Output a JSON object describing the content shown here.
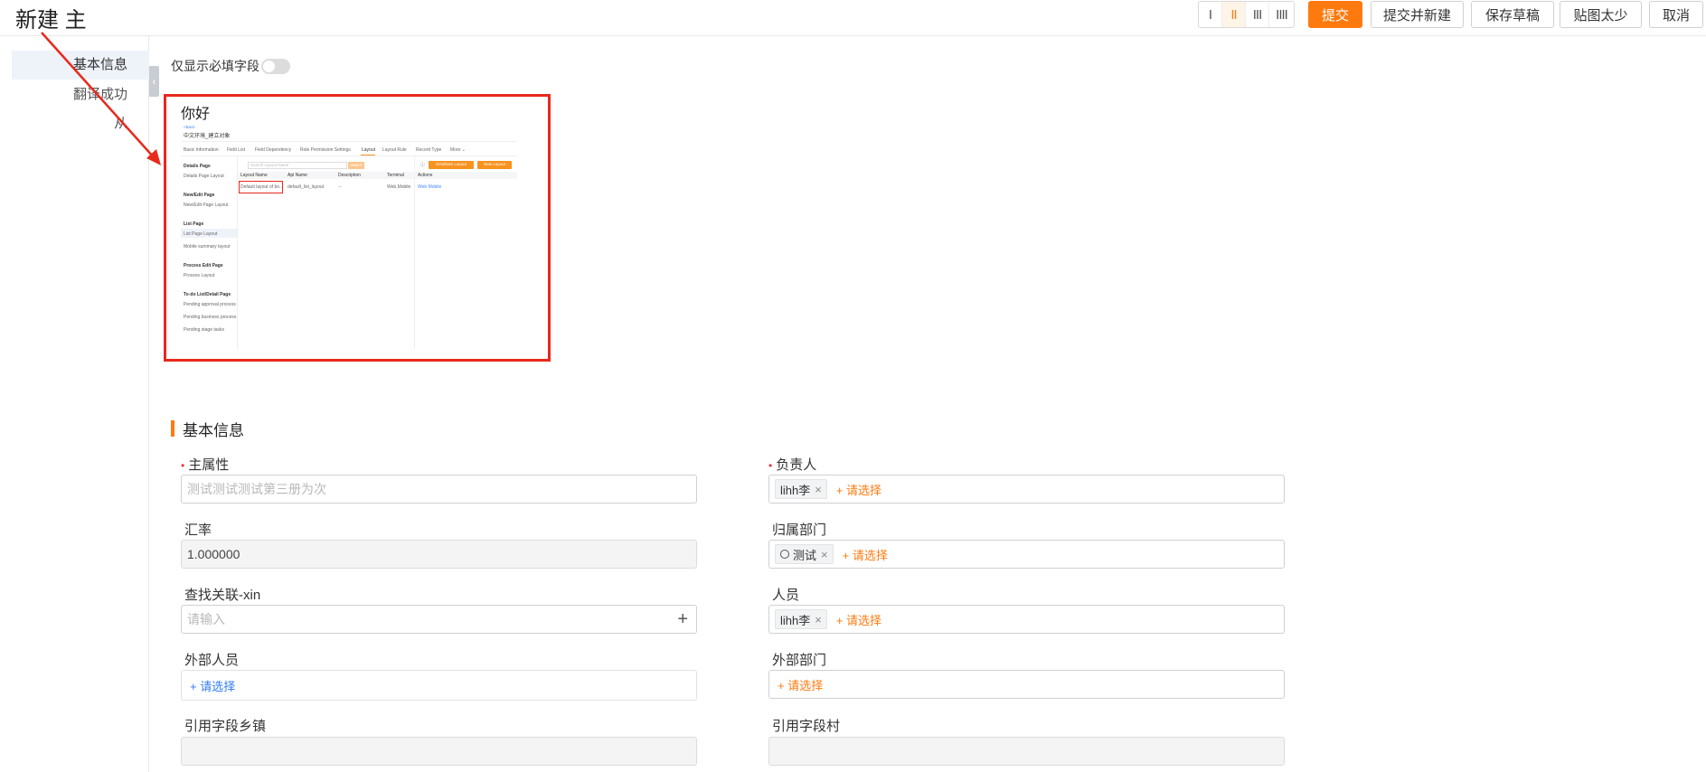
{
  "header": {
    "title": "新建 主",
    "column_options": [
      "I",
      "II",
      "III",
      "IIII"
    ],
    "active_column": 1,
    "buttons": {
      "submit": "提交",
      "submit_new": "提交并新建",
      "save_draft": "保存草稿",
      "image_small": "贴图太少",
      "cancel": "取消"
    }
  },
  "sidebar": {
    "items": [
      {
        "label": "基本信息",
        "active": true
      },
      {
        "label": "翻译成功",
        "active": false
      },
      {
        "label": "从",
        "active": false
      }
    ]
  },
  "toggle": {
    "label": "仅显示必填字段",
    "on": false
  },
  "rich_text": {
    "heading": "你好",
    "embedded": {
      "back": "<Back",
      "object_name": "中文环境_建立对象",
      "tabs": [
        "Basic Information",
        "Field List",
        "Field Dependency",
        "Role Permission Settings",
        "Layout",
        "Layout Rule",
        "Record Type",
        "More ⌄"
      ],
      "active_tab": "Layout",
      "left_groups": [
        {
          "title": "Details Page",
          "items": [
            "Details Page Layout"
          ]
        },
        {
          "title": "New/Edit Page",
          "items": [
            "New/Edit Page Layout"
          ]
        },
        {
          "title": "List Page",
          "items": [
            "List Page Layout",
            "Mobile summary layout"
          ]
        },
        {
          "title": "Process Edit Page",
          "items": [
            "Process Layout"
          ]
        },
        {
          "title": "To-do List/Detail Page",
          "items": [
            "Pending approval process",
            "Pending business process",
            "Pending stage tasks"
          ]
        }
      ],
      "search_placeholder": "Search Layout Name",
      "search_btn": "Search",
      "distribute_btn": "Distribute Layout",
      "new_btn": "New Layout",
      "columns": [
        "Layout Name",
        "Api Name",
        "Description",
        "Terminal",
        "Actions"
      ],
      "row": [
        "Default layout of bo...",
        "default_list_layout",
        "--",
        "Web,Mobile",
        "Web  Mobile"
      ]
    }
  },
  "arrow_color": "#e8291c",
  "accent": "#ff7a0e",
  "section_title": "基本信息",
  "form": {
    "main_attr": {
      "label": "主属性",
      "required": true,
      "placeholder": "测试测试测试第三册为次"
    },
    "owner": {
      "label": "负责人",
      "required": true,
      "tag": "lihh李",
      "pick": "+ 请选择"
    },
    "exchange_rate": {
      "label": "汇率",
      "value": "1.000000"
    },
    "department": {
      "label": "归属部门",
      "tag": "测试",
      "pick": "+ 请选择"
    },
    "lookup": {
      "label": "查找关联-xin",
      "placeholder": "请输入"
    },
    "staff": {
      "label": "人员",
      "tag": "lihh李",
      "pick": "+ 请选择"
    },
    "external_staff": {
      "label": "外部人员",
      "pick": "+ 请选择"
    },
    "external_department": {
      "label": "外部部门",
      "pick": "+ 请选择"
    },
    "ref_town": {
      "label": "引用字段乡镇"
    },
    "ref_village": {
      "label": "引用字段村"
    }
  }
}
